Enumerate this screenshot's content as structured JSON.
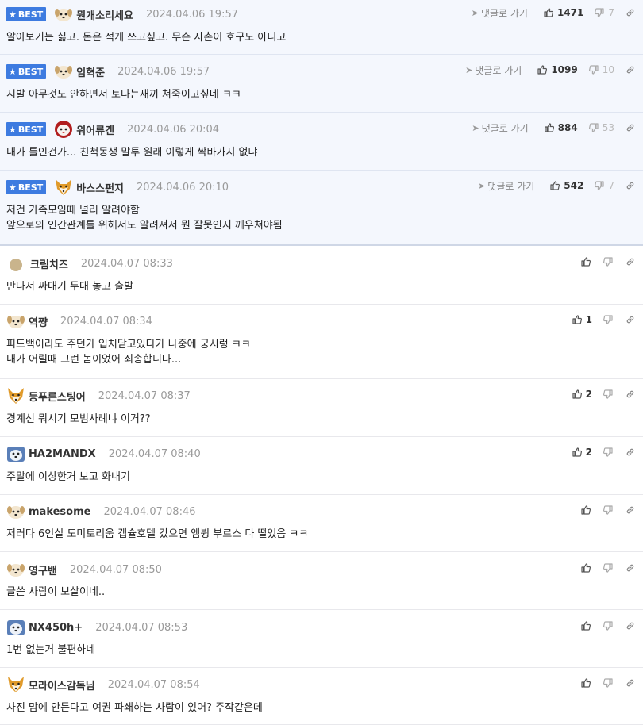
{
  "labels": {
    "best": "BEST",
    "goto": "댓글로 가기"
  },
  "colors": {
    "best_badge": "#3d7be0",
    "best_bg": "#f4f7fd",
    "date": "#9a9a9a"
  },
  "comments": [
    {
      "best": true,
      "avatar": "dog-face-icon",
      "nick": "뭔개소리세요",
      "date": "2024.04.06 19:57",
      "up": "1471",
      "down": "7",
      "text": "알아보기는 싫고. 돈은 적게 쓰고싶고. 무슨 사촌이 호구도 아니고"
    },
    {
      "best": true,
      "avatar": "dog-face-icon",
      "nick": "임혁준",
      "date": "2024.04.06 19:57",
      "up": "1099",
      "down": "10",
      "text": "시발 아무것도 안하면서 토다는새끼 쳐죽이고싶네 ㅋㅋ"
    },
    {
      "best": true,
      "avatar": "cat-face-icon",
      "nick": "워어류겐",
      "date": "2024.04.06 20:04",
      "up": "884",
      "down": "53",
      "text": "내가 틀인건가... 친척동생 말투 원래 이렇게 싹바가지 없냐"
    },
    {
      "best": true,
      "avatar": "fox-face-icon",
      "nick": "바스스펀지",
      "date": "2024.04.06 20:10",
      "up": "542",
      "down": "7",
      "text": "저건 가족모임때 널리 알려야함\n앞으로의 인간관계를 위해서도 알려져서 뭔 잘못인지 깨우쳐야됨"
    },
    {
      "best": false,
      "avatar": "circle-avatar-icon",
      "nick": "크림치즈",
      "date": "2024.04.07 08:33",
      "up": "",
      "down": "",
      "text": "만나서 싸대기 두대 놓고 출발"
    },
    {
      "best": false,
      "avatar": "dog-face-icon",
      "nick": "역쨩",
      "date": "2024.04.07 08:34",
      "up": "1",
      "down": "",
      "text": "피드백이라도 주던가 입처닫고있다가 나중에 궁시렁 ㅋㅋ\n내가 어릴때 그런 놈이었어 죄송합니다..."
    },
    {
      "best": false,
      "avatar": "fox-face-icon",
      "nick": "등푸른스팅어",
      "date": "2024.04.07 08:37",
      "up": "2",
      "down": "",
      "text": "경계선 뭐시기 모범사례냐 이거??"
    },
    {
      "best": false,
      "avatar": "husky-face-icon",
      "nick": "HA2MANDX",
      "date": "2024.04.07 08:40",
      "up": "2",
      "down": "",
      "text": "주말에 이상한거 보고 화내기"
    },
    {
      "best": false,
      "avatar": "dog-face-icon",
      "nick": "makesome",
      "date": "2024.04.07 08:46",
      "up": "",
      "down": "",
      "text": "저러다 6인실 도미토리움 캡슐호텔 갔으면 앰뷩 부르스 다 떨었음 ㅋㅋ"
    },
    {
      "best": false,
      "avatar": "dog-face-icon",
      "nick": "영구밴",
      "date": "2024.04.07 08:50",
      "up": "",
      "down": "",
      "text": "글쓴 사람이 보살이네.."
    },
    {
      "best": false,
      "avatar": "husky-face-icon",
      "nick": "NX450h+",
      "date": "2024.04.07 08:53",
      "up": "",
      "down": "",
      "text": "1번 없는거 불편하네"
    },
    {
      "best": false,
      "avatar": "fox-face-icon",
      "nick": "모라이스감독님",
      "date": "2024.04.07 08:54",
      "up": "",
      "down": "",
      "text": "사진 맘에 안든다고 여권 파쇄하는 사람이 있어? 주작같은데"
    }
  ]
}
